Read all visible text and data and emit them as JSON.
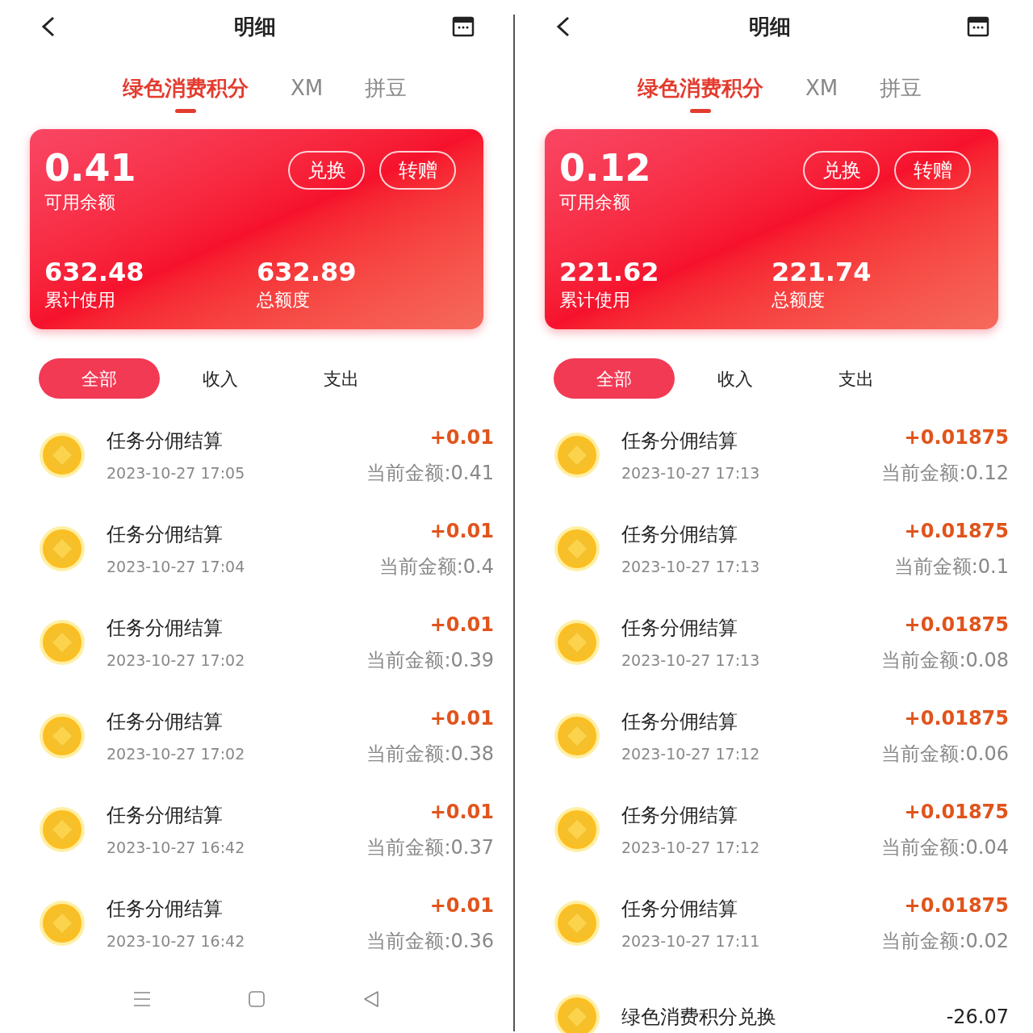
{
  "panels": [
    {
      "header": {
        "title": "明细"
      },
      "tabs": [
        {
          "label": "绿色消费积分",
          "selected": true
        },
        {
          "label": "XM",
          "selected": false
        },
        {
          "label": "拼豆",
          "selected": false
        }
      ],
      "card": {
        "balance": "0.41",
        "balance_label": "可用余额",
        "buttons": [
          "兑换",
          "转赠"
        ],
        "stats": [
          {
            "value": "632.48",
            "label": "累计使用"
          },
          {
            "value": "632.89",
            "label": "总额度"
          }
        ]
      },
      "filters": [
        {
          "label": "全部",
          "selected": true
        },
        {
          "label": "收入",
          "selected": false
        },
        {
          "label": "支出",
          "selected": false
        }
      ],
      "records": [
        {
          "kind": "income",
          "title": "任务分佣结算",
          "time": "2023-10-27 17:05",
          "amount": "+0.01",
          "current": "当前金额:0.41"
        },
        {
          "kind": "income",
          "title": "任务分佣结算",
          "time": "2023-10-27 17:04",
          "amount": "+0.01",
          "current": "当前金额:0.4"
        },
        {
          "kind": "income",
          "title": "任务分佣结算",
          "time": "2023-10-27 17:02",
          "amount": "+0.01",
          "current": "当前金额:0.39"
        },
        {
          "kind": "income",
          "title": "任务分佣结算",
          "time": "2023-10-27 17:02",
          "amount": "+0.01",
          "current": "当前金额:0.38"
        },
        {
          "kind": "income",
          "title": "任务分佣结算",
          "time": "2023-10-27 16:42",
          "amount": "+0.01",
          "current": "当前金额:0.37"
        },
        {
          "kind": "income",
          "title": "任务分佣结算",
          "time": "2023-10-27 16:42",
          "amount": "+0.01",
          "current": "当前金额:0.36"
        }
      ],
      "nav_bar": true
    },
    {
      "header": {
        "title": "明细"
      },
      "tabs": [
        {
          "label": "绿色消费积分",
          "selected": true
        },
        {
          "label": "XM",
          "selected": false
        },
        {
          "label": "拼豆",
          "selected": false
        }
      ],
      "card": {
        "balance": "0.12",
        "balance_label": "可用余额",
        "buttons": [
          "兑换",
          "转赠"
        ],
        "stats": [
          {
            "value": "221.62",
            "label": "累计使用"
          },
          {
            "value": "221.74",
            "label": "总额度"
          }
        ]
      },
      "filters": [
        {
          "label": "全部",
          "selected": true
        },
        {
          "label": "收入",
          "selected": false
        },
        {
          "label": "支出",
          "selected": false
        }
      ],
      "records": [
        {
          "kind": "income",
          "title": "任务分佣结算",
          "time": "2023-10-27 17:13",
          "amount": "+0.01875",
          "current": "当前金额:0.12"
        },
        {
          "kind": "income",
          "title": "任务分佣结算",
          "time": "2023-10-27 17:13",
          "amount": "+0.01875",
          "current": "当前金额:0.1"
        },
        {
          "kind": "income",
          "title": "任务分佣结算",
          "time": "2023-10-27 17:13",
          "amount": "+0.01875",
          "current": "当前金额:0.08"
        },
        {
          "kind": "income",
          "title": "任务分佣结算",
          "time": "2023-10-27 17:12",
          "amount": "+0.01875",
          "current": "当前金额:0.06"
        },
        {
          "kind": "income",
          "title": "任务分佣结算",
          "time": "2023-10-27 17:12",
          "amount": "+0.01875",
          "current": "当前金额:0.04"
        },
        {
          "kind": "income",
          "title": "任务分佣结算",
          "time": "2023-10-27 17:11",
          "amount": "+0.01875",
          "current": "当前金额:0.02"
        },
        {
          "kind": "expense",
          "title": "绿色消费积分兑换",
          "amount": "-26.07"
        }
      ],
      "nav_bar": false
    }
  ]
}
